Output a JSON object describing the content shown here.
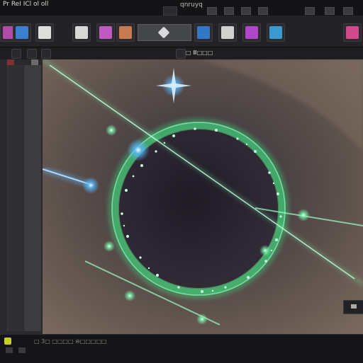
{
  "window": {
    "title": "Pr ReI ICl ol oll"
  },
  "toolbar": {
    "label_center": "qnruyq",
    "buttons": [
      {
        "name": "tool-1",
        "icon": "purple-cube-icon",
        "color": "#b04ca8"
      },
      {
        "name": "tool-2",
        "icon": "blue-window-icon",
        "color": "#3a7fd0"
      },
      {
        "name": "tool-3",
        "icon": "brush-icon",
        "color": "#dedede"
      },
      {
        "name": "tool-4",
        "icon": "paper-icon",
        "color": "#d8d8d8"
      },
      {
        "name": "tool-5",
        "icon": "pink-cube-icon",
        "color": "#c05abf"
      },
      {
        "name": "tool-6",
        "icon": "image-icon",
        "color": "#c87a52"
      },
      {
        "name": "tool-7",
        "icon": "blue-square-icon",
        "color": "#3377c9"
      },
      {
        "name": "tool-8",
        "icon": "monitor-icon",
        "color": "#d0d0d0"
      },
      {
        "name": "tool-9",
        "icon": "purple-gem-icon",
        "color": "#b046c8"
      },
      {
        "name": "tool-10",
        "icon": "cyan-box-icon",
        "color": "#3a9ad0"
      },
      {
        "name": "tool-11",
        "icon": "pink-box-icon",
        "color": "#cf4a8a"
      }
    ]
  },
  "subbar": {
    "label": "□ Ⅲ□□□"
  },
  "timeline": {
    "text": "□ 3□ □□□□ ⊖□□□□□"
  },
  "colors": {
    "ring": "#42e07e",
    "beam_green": "#7cffb0",
    "beam_blue": "#3fa8ff",
    "bg": "#1b1b1d"
  }
}
